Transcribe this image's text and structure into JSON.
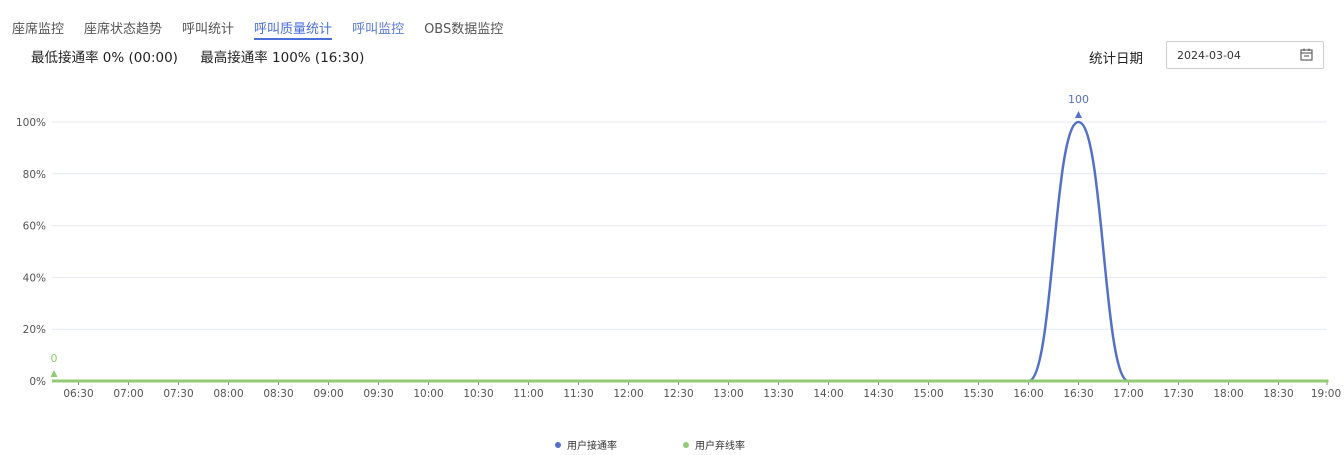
{
  "tabs": [
    {
      "label": "座席监控",
      "active": false,
      "link": false
    },
    {
      "label": "座席状态趋势",
      "active": false,
      "link": false
    },
    {
      "label": "呼叫统计",
      "active": false,
      "link": false
    },
    {
      "label": "呼叫质量统计",
      "active": true,
      "link": false
    },
    {
      "label": "呼叫监控",
      "active": false,
      "link": true
    },
    {
      "label": "OBS数据监控",
      "active": false,
      "link": false
    }
  ],
  "summary": {
    "min_rate": "最低接通率 0% (00:00)",
    "max_rate": "最高接通率 100% (16:30)"
  },
  "date_filter": {
    "label": "统计日期",
    "value": "2024-03-04",
    "icon": "calendar-icon"
  },
  "colors": {
    "answer_rate": "#5470c6",
    "abandon_rate": "#91cc75",
    "active_tab": "#4a6fd8"
  },
  "chart_data": {
    "type": "line",
    "x": [
      "06:30",
      "07:00",
      "07:30",
      "08:00",
      "08:30",
      "09:00",
      "09:30",
      "10:00",
      "10:30",
      "11:00",
      "11:30",
      "12:00",
      "12:30",
      "13:00",
      "13:30",
      "14:00",
      "14:30",
      "15:00",
      "15:30",
      "16:00",
      "16:30",
      "17:00",
      "17:30",
      "18:00",
      "18:30",
      "19:00"
    ],
    "y_ticks": [
      "0%",
      "20%",
      "40%",
      "60%",
      "80%",
      "100%"
    ],
    "ylim": [
      0,
      100
    ],
    "series": [
      {
        "name": "用户接通率",
        "values": [
          0,
          0,
          0,
          0,
          0,
          0,
          0,
          0,
          0,
          0,
          0,
          0,
          0,
          0,
          0,
          0,
          0,
          0,
          0,
          0,
          100,
          0,
          0,
          0,
          0,
          0
        ]
      },
      {
        "name": "用户弃线率",
        "values": [
          0,
          0,
          0,
          0,
          0,
          0,
          0,
          0,
          0,
          0,
          0,
          0,
          0,
          0,
          0,
          0,
          0,
          0,
          0,
          0,
          0,
          0,
          0,
          0,
          0,
          0
        ]
      }
    ],
    "annotations": [
      {
        "series": "用户接通率",
        "label": "100",
        "at": "16:30",
        "value": 100
      },
      {
        "series": "用户弃线率",
        "label": "0",
        "at": "start",
        "value": 0
      }
    ],
    "grid": true,
    "legend_position": "bottom-center"
  }
}
